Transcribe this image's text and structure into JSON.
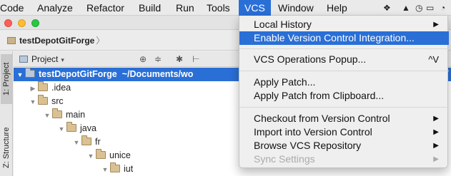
{
  "menubar": {
    "items": [
      "Code",
      "Analyze",
      "Refactor",
      "Build",
      "Run",
      "Tools",
      "VCS",
      "Window",
      "Help"
    ],
    "active": "VCS",
    "tray_icons": [
      "dropbox-icon",
      "drive-icon",
      "backup-icon",
      "battery-icon",
      "wifi-icon"
    ]
  },
  "window": {
    "breadcrumb": "testDepotGitForge"
  },
  "sidebar": {
    "tabs": [
      "1: Project",
      "Z: Structure"
    ]
  },
  "project_panel": {
    "title": "Project",
    "tools": [
      "⊕",
      "≑",
      "✱",
      "⊢"
    ]
  },
  "tree": [
    {
      "label": "testDepotGitForge",
      "extra": "~/Documents/wo",
      "depth": 0,
      "expanded": true,
      "selected": true
    },
    {
      "label": ".idea",
      "depth": 1,
      "expanded": false
    },
    {
      "label": "src",
      "depth": 1,
      "expanded": true
    },
    {
      "label": "main",
      "depth": 2,
      "expanded": true
    },
    {
      "label": "java",
      "depth": 3,
      "expanded": true
    },
    {
      "label": "fr",
      "depth": 4,
      "expanded": true
    },
    {
      "label": "unice",
      "depth": 5,
      "expanded": true
    },
    {
      "label": "iut",
      "depth": 6,
      "expanded": true
    }
  ],
  "vcs_menu": {
    "items": [
      {
        "label": "Local History",
        "submenu": true
      },
      {
        "label": "Enable Version Control Integration...",
        "highlighted": true
      },
      {
        "separator": true
      },
      {
        "label": "VCS Operations Popup...",
        "shortcut": "^V"
      },
      {
        "separator": true
      },
      {
        "label": "Apply Patch..."
      },
      {
        "label": "Apply Patch from Clipboard..."
      },
      {
        "separator": true
      },
      {
        "label": "Checkout from Version Control",
        "submenu": true
      },
      {
        "label": "Import into Version Control",
        "submenu": true
      },
      {
        "label": "Browse VCS Repository",
        "submenu": true
      },
      {
        "label": "Sync Settings",
        "submenu": true,
        "disabled": true
      }
    ]
  }
}
